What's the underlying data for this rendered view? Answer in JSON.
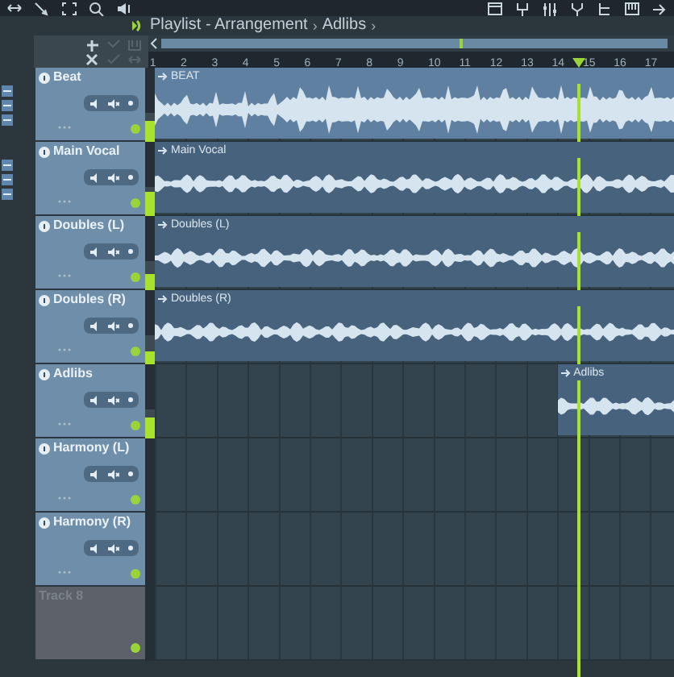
{
  "breadcrumb": [
    {
      "label": "Playlist - Arrangement"
    },
    {
      "label": "Adlibs"
    }
  ],
  "separator": "›",
  "ruler": [
    "1",
    "2",
    "3",
    "4",
    "5",
    "6",
    "7",
    "8",
    "9",
    "10",
    "11",
    "12",
    "13",
    "14",
    "15",
    "16",
    "17"
  ],
  "tracks": [
    {
      "name": "Beat",
      "active": true,
      "meter": {
        "level": 0.75
      },
      "clip": {
        "label": "BEAT",
        "kind": "beat",
        "late": false
      }
    },
    {
      "name": "Main Vocal",
      "active": true,
      "meter": {
        "level": 0.85
      },
      "clip": {
        "label": "Main Vocal",
        "kind": "vocal",
        "late": false
      }
    },
    {
      "name": "Doubles (L)",
      "active": true,
      "meter": {
        "level": 0.55
      },
      "clip": {
        "label": "Doubles (L)",
        "kind": "vocal",
        "late": false
      }
    },
    {
      "name": "Doubles (R)",
      "active": true,
      "meter": {
        "level": 0.45
      },
      "clip": {
        "label": "Doubles (R)",
        "kind": "vocal",
        "late": false
      }
    },
    {
      "name": "Adlibs",
      "active": true,
      "meter": {
        "level": 0.7
      },
      "clip": {
        "label": "Adlibs",
        "kind": "vocal",
        "late": true
      }
    },
    {
      "name": "Harmony (L)",
      "active": true
    },
    {
      "name": "Harmony (R)",
      "active": true
    },
    {
      "name": "Track 8",
      "active": false
    }
  ]
}
